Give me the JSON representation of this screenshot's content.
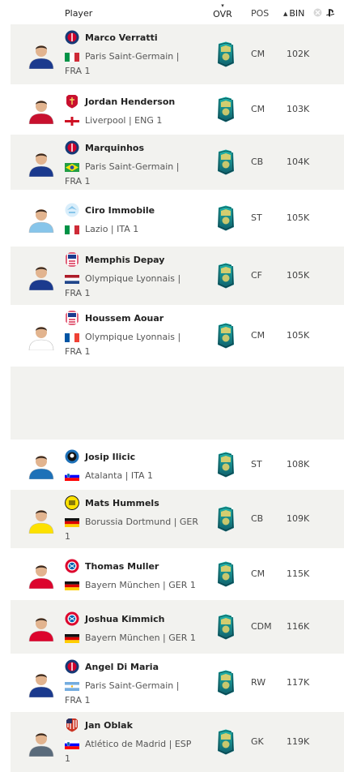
{
  "header": {
    "player": "Player",
    "ovr": "OVR",
    "pos": "POS",
    "bin": "BIN",
    "sort_arrow": "▲"
  },
  "colors": {
    "row_alt": "#f2f2ef",
    "card_teal": "#1c8f8a"
  },
  "players": [
    {
      "name": "Marco Verratti",
      "club": "Paris Saint-Germain | ",
      "club2": "FRA 1",
      "pos": "CM",
      "price": "102K",
      "crest": "psg",
      "flag": "ita"
    },
    {
      "name": "Jordan Henderson",
      "club": "Liverpool | ENG 1",
      "club2": "",
      "pos": "CM",
      "price": "103K",
      "crest": "liverpool",
      "flag": "eng"
    },
    {
      "name": "Marquinhos",
      "club": "Paris Saint-Germain | ",
      "club2": "FRA 1",
      "pos": "CB",
      "price": "104K",
      "crest": "psg",
      "flag": "bra"
    },
    {
      "name": "Ciro Immobile",
      "club": "Lazio | ITA 1",
      "club2": "",
      "pos": "ST",
      "price": "105K",
      "crest": "lazio",
      "flag": "ita"
    },
    {
      "name": "Memphis Depay",
      "club": "Olympique Lyonnais | ",
      "club2": "FRA 1",
      "pos": "CF",
      "price": "105K",
      "crest": "lyon",
      "flag": "ned"
    },
    {
      "name": "Houssem Aouar",
      "club": "Olympique Lyonnais | ",
      "club2": "FRA 1",
      "pos": "CM",
      "price": "105K",
      "crest": "lyon",
      "flag": "fra"
    },
    {
      "name": "Josip Ilicic",
      "club": "Atalanta | ITA 1",
      "club2": "",
      "pos": "ST",
      "price": "108K",
      "crest": "atalanta",
      "flag": "svn"
    },
    {
      "name": "Mats Hummels",
      "club": "Borussia Dortmund | GER ",
      "club2": "1",
      "pos": "CB",
      "price": "109K",
      "crest": "bvb",
      "flag": "ger"
    },
    {
      "name": "Thomas Muller",
      "club": "Bayern München | GER 1",
      "club2": "",
      "pos": "CM",
      "price": "115K",
      "crest": "bayern",
      "flag": "ger"
    },
    {
      "name": "Joshua Kimmich",
      "club": "Bayern München | GER 1",
      "club2": "",
      "pos": "CDM",
      "price": "116K",
      "crest": "bayern",
      "flag": "ger"
    },
    {
      "name": "Angel Di Maria",
      "club": "Paris Saint-Germain | ",
      "club2": "FRA 1",
      "pos": "RW",
      "price": "117K",
      "crest": "psg",
      "flag": "arg"
    },
    {
      "name": "Jan Oblak",
      "club": "Atlético de Madrid | ESP ",
      "club2": "1",
      "pos": "GK",
      "price": "119K",
      "crest": "atletico",
      "flag": "svn"
    }
  ]
}
